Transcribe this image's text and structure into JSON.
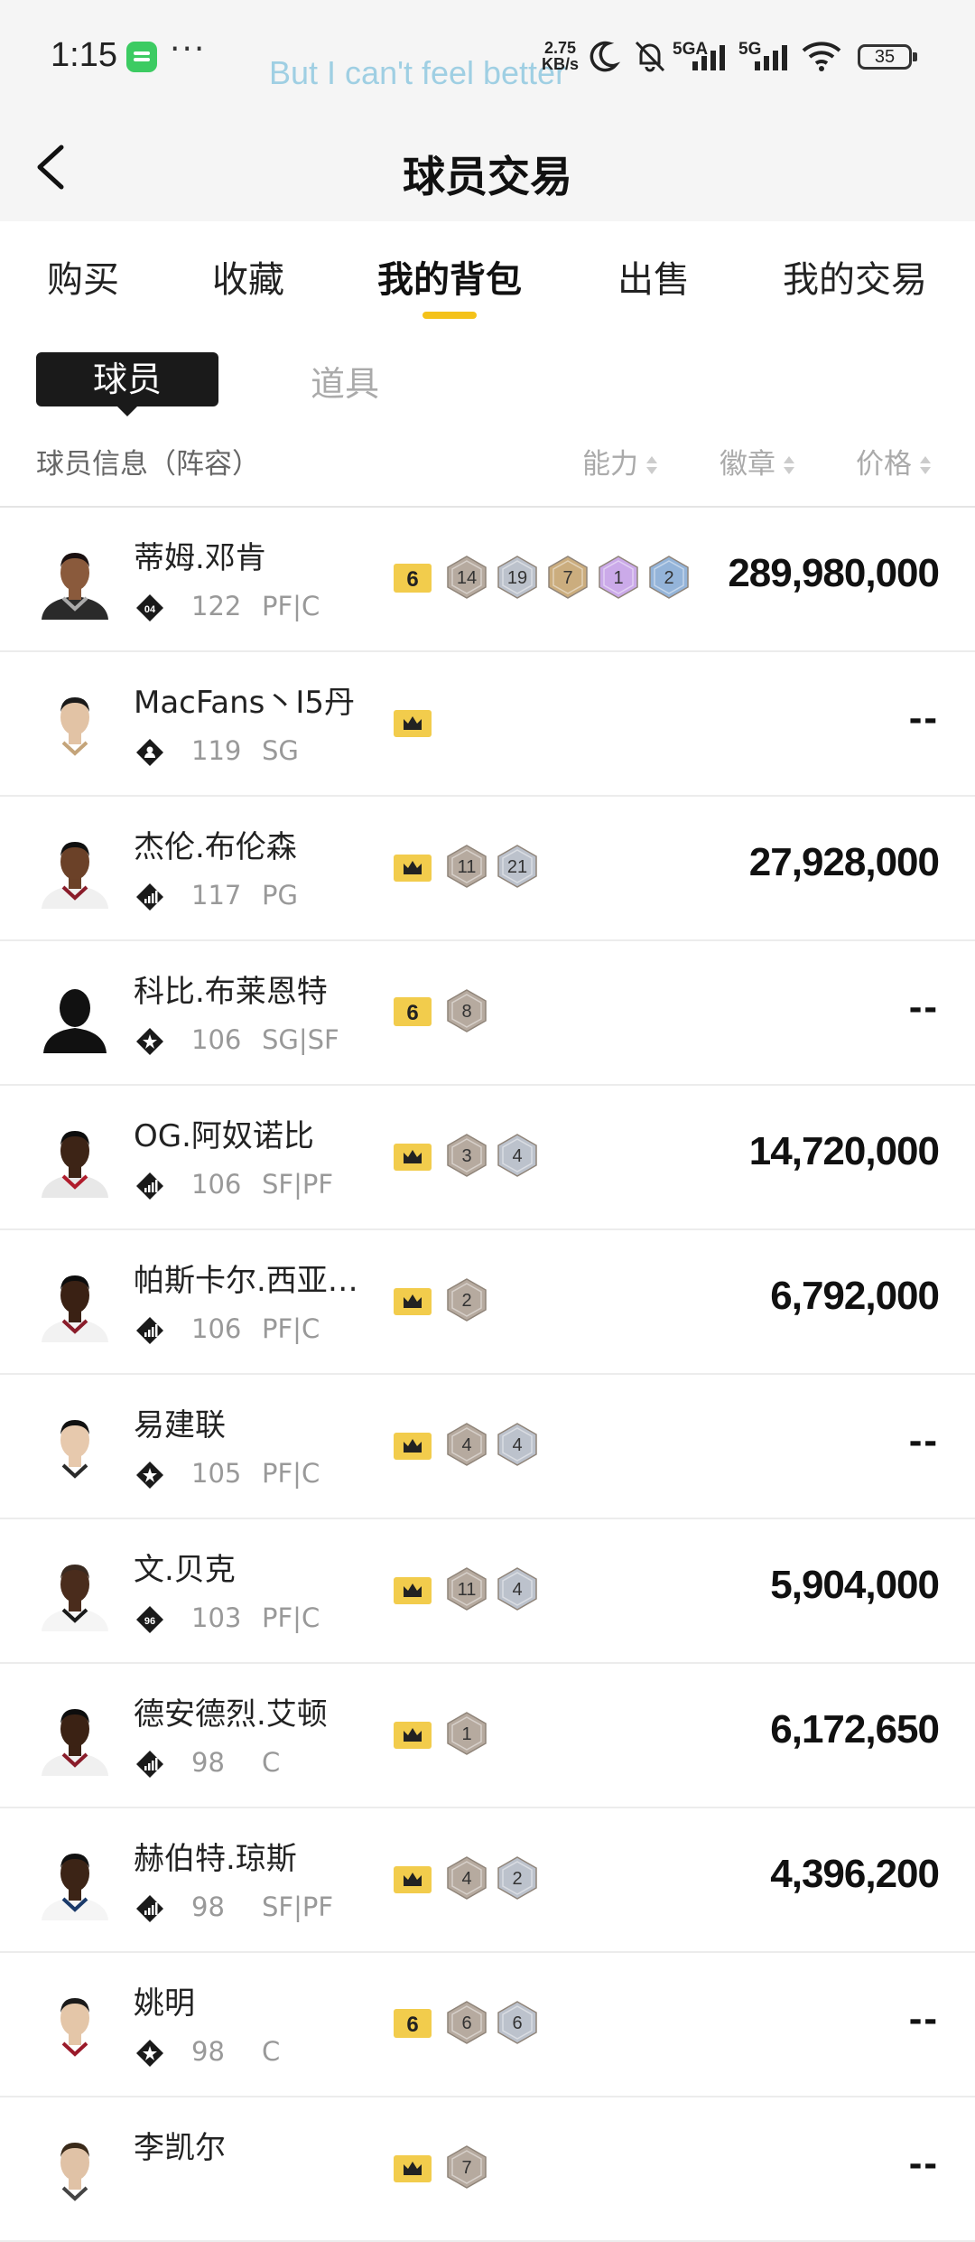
{
  "status_bar": {
    "time": "1:15",
    "lyric": "But I can't feel better",
    "net_speed_value": "2.75",
    "net_speed_unit": "KB/s",
    "network_1": "5GA",
    "network_2": "5G",
    "battery": "35",
    "icons": [
      "spotify-icon",
      "more-icon",
      "moon-icon",
      "mute-bell-icon",
      "signal-icon",
      "signal-icon",
      "wifi-icon",
      "battery-icon"
    ]
  },
  "header": {
    "title": "球员交易",
    "back_icon": "chevron-left-icon"
  },
  "tabs": [
    "购买",
    "收藏",
    "我的背包",
    "出售",
    "我的交易"
  ],
  "active_tab": "我的背包",
  "accent_color": "#f4c21a",
  "subtabs": {
    "active": "球员",
    "inactive": "道具"
  },
  "columns": {
    "info": "球员信息（阵容）",
    "ability": "能力",
    "badges": "徽章",
    "price": "价格"
  },
  "players": [
    {
      "name": "蒂姆.邓肯",
      "rating": "122",
      "position": "PF|C",
      "price": "289,980,000",
      "badges": [
        {
          "type": "gold-num",
          "label": "6"
        },
        {
          "type": "hex",
          "color": "#b3a69a",
          "label": "14"
        },
        {
          "type": "hex",
          "color": "#b9bfca",
          "label": "19"
        },
        {
          "type": "hex",
          "color": "#c9a978",
          "label": "7"
        },
        {
          "type": "hex",
          "color": "#c9a6e8",
          "label": "1"
        },
        {
          "type": "hex",
          "color": "#8fb0d8",
          "label": "2"
        }
      ]
    },
    {
      "name": "MacFans丶I5丹",
      "rating": "119",
      "position": "SG",
      "price": "--",
      "badges": [
        {
          "type": "gold-crown",
          "label": ""
        }
      ]
    },
    {
      "name": "杰伦.布伦森",
      "rating": "117",
      "position": "PG",
      "price": "27,928,000",
      "badges": [
        {
          "type": "gold-crown",
          "label": ""
        },
        {
          "type": "hex",
          "color": "#b3a69a",
          "label": "11"
        },
        {
          "type": "hex",
          "color": "#b9bfca",
          "label": "21"
        }
      ]
    },
    {
      "name": "科比.布莱恩特",
      "rating": "106",
      "position": "SG|SF",
      "price": "--",
      "badges": [
        {
          "type": "gold-num",
          "label": "6"
        },
        {
          "type": "hex",
          "color": "#b3a69a",
          "label": "8"
        }
      ]
    },
    {
      "name": "OG.阿奴诺比",
      "rating": "106",
      "position": "SF|PF",
      "price": "14,720,000",
      "badges": [
        {
          "type": "gold-crown",
          "label": ""
        },
        {
          "type": "hex",
          "color": "#b3a69a",
          "label": "3"
        },
        {
          "type": "hex",
          "color": "#b9bfca",
          "label": "4"
        }
      ]
    },
    {
      "name": "帕斯卡尔.西亚…",
      "rating": "106",
      "position": "PF|C",
      "price": "6,792,000",
      "badges": [
        {
          "type": "gold-crown",
          "label": ""
        },
        {
          "type": "hex",
          "color": "#b3a69a",
          "label": "2"
        }
      ]
    },
    {
      "name": "易建联",
      "rating": "105",
      "position": "PF|C",
      "price": "--",
      "badges": [
        {
          "type": "gold-crown",
          "label": ""
        },
        {
          "type": "hex",
          "color": "#b3a69a",
          "label": "4"
        },
        {
          "type": "hex",
          "color": "#b9bfca",
          "label": "4"
        }
      ]
    },
    {
      "name": "文.贝克",
      "rating": "103",
      "position": "PF|C",
      "price": "5,904,000",
      "badges": [
        {
          "type": "gold-crown",
          "label": ""
        },
        {
          "type": "hex",
          "color": "#b3a69a",
          "label": "11"
        },
        {
          "type": "hex",
          "color": "#b9bfca",
          "label": "4"
        }
      ]
    },
    {
      "name": "德安德烈.艾顿",
      "rating": "98",
      "position": "C",
      "price": "6,172,650",
      "badges": [
        {
          "type": "gold-crown",
          "label": ""
        },
        {
          "type": "hex",
          "color": "#b3a69a",
          "label": "1"
        }
      ]
    },
    {
      "name": "赫伯特.琼斯",
      "rating": "98",
      "position": "SF|PF",
      "price": "4,396,200",
      "badges": [
        {
          "type": "gold-crown",
          "label": ""
        },
        {
          "type": "hex",
          "color": "#b3a69a",
          "label": "4"
        },
        {
          "type": "hex",
          "color": "#b9bfca",
          "label": "2"
        }
      ]
    },
    {
      "name": "姚明",
      "rating": "98",
      "position": "C",
      "price": "--",
      "badges": [
        {
          "type": "gold-num",
          "label": "6"
        },
        {
          "type": "hex",
          "color": "#b3a69a",
          "label": "6"
        },
        {
          "type": "hex",
          "color": "#b9bfca",
          "label": "6"
        }
      ]
    },
    {
      "name": "李凯尔",
      "rating": "",
      "position": "",
      "price": "--",
      "badges": [
        {
          "type": "gold-crown",
          "label": ""
        },
        {
          "type": "hex",
          "color": "#b3a69a",
          "label": "7"
        }
      ]
    }
  ],
  "rating_icons": [
    "lineup-icon-04",
    "lineup-icon-person",
    "lineup-icon-bars",
    "lineup-icon-star",
    "lineup-icon-bars",
    "lineup-icon-bars",
    "lineup-icon-star",
    "lineup-icon-96",
    "lineup-icon-bars",
    "lineup-icon-bars",
    "lineup-icon-star",
    "lineup-icon-bars"
  ]
}
